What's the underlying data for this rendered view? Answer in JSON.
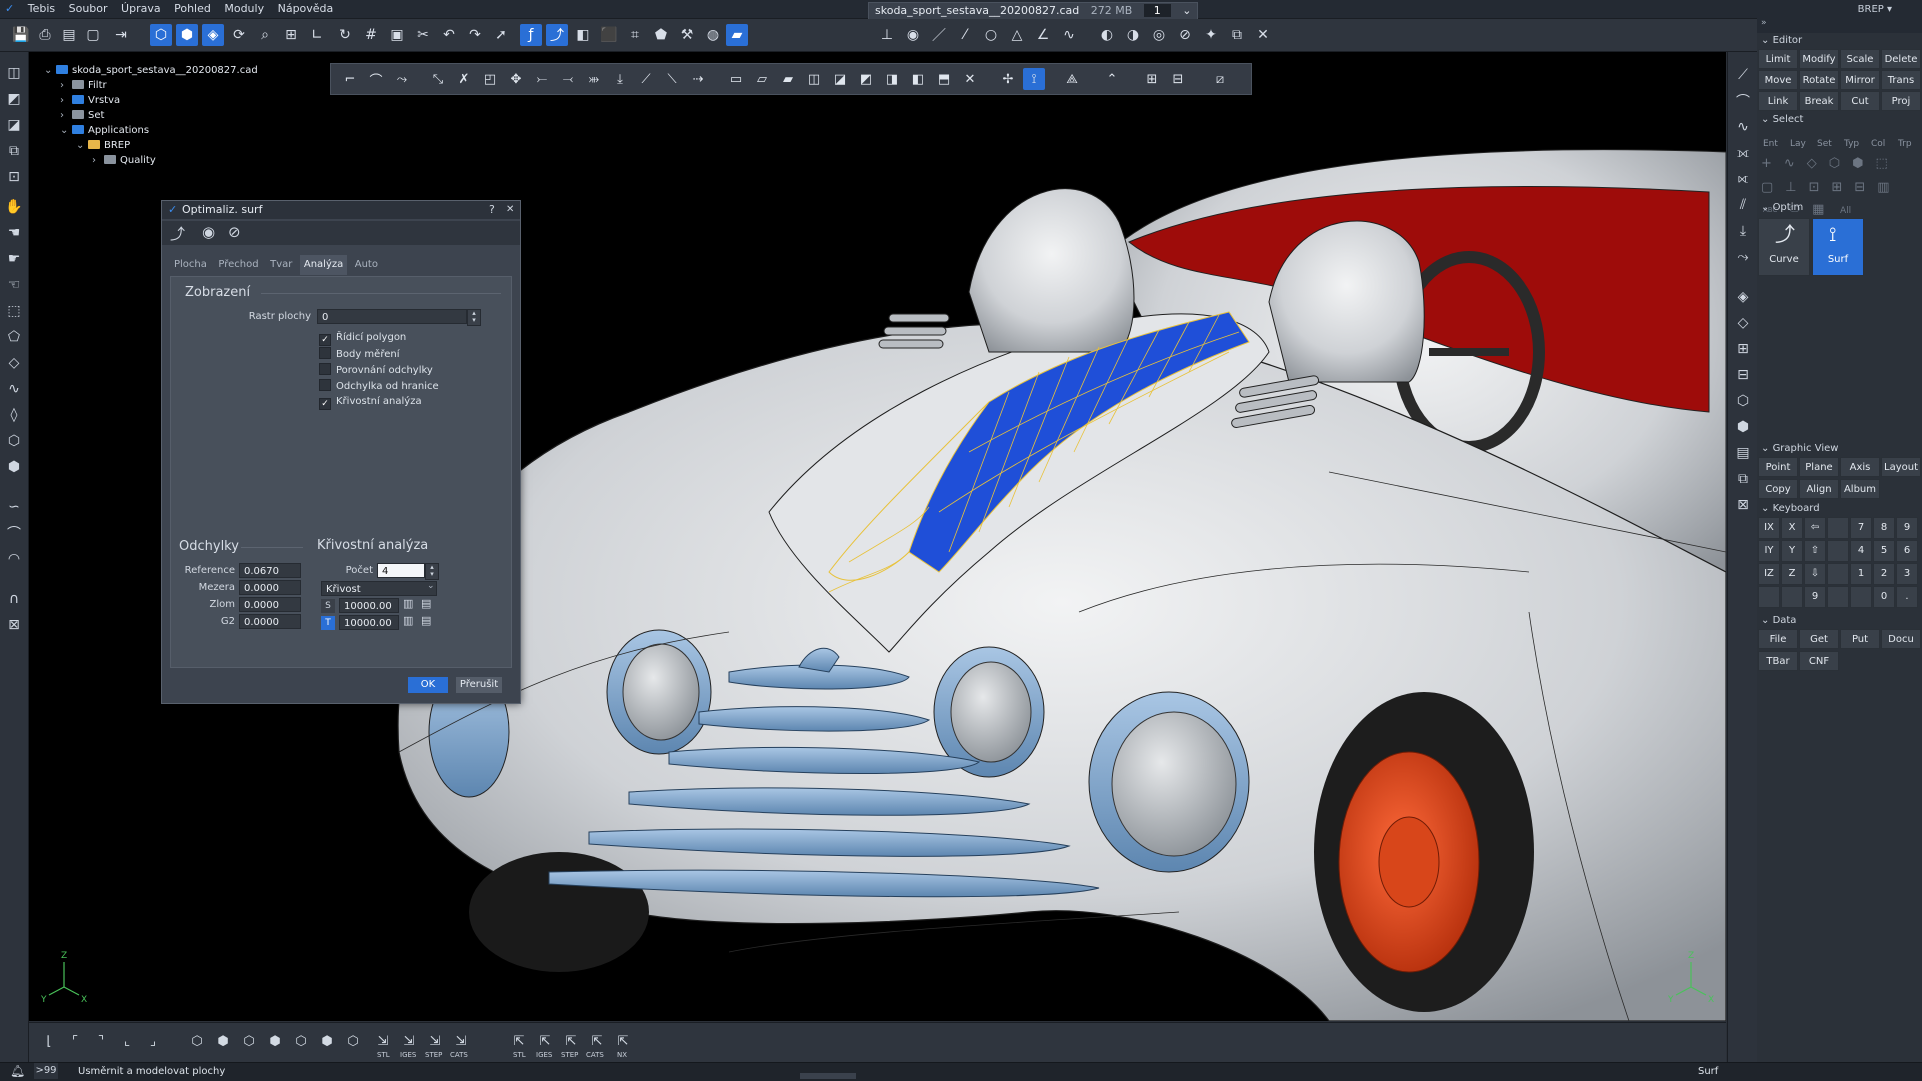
{
  "menu": {
    "app": "Tebis",
    "items": [
      "Soubor",
      "Úprava",
      "Pohled",
      "Moduly",
      "Nápověda"
    ]
  },
  "file_tab": {
    "name": "skoda_sport_sestava__20200827.cad",
    "size": "272 MB",
    "num": "1"
  },
  "mode_label": "BREP ▾",
  "tree": {
    "root": "skoda_sport_sestava__20200827.cad",
    "items": [
      {
        "label": "Filtr",
        "color": "#8a939e"
      },
      {
        "label": "Vrstva",
        "color": "#2f7fe0"
      },
      {
        "label": "Set",
        "color": "#8a939e"
      },
      {
        "label": "Applications",
        "color": "#2f7fe0"
      },
      {
        "label": "BREP",
        "color": "#e8b64a"
      },
      {
        "label": "Quality",
        "color": "#8a939e"
      }
    ]
  },
  "dialog": {
    "title": "Optimaliz. surf",
    "help": "?",
    "close": "✕",
    "tabs": [
      "Plocha",
      "Přechod",
      "Tvar",
      "Analýza",
      "Auto"
    ],
    "active_tab": "Analýza",
    "zobrazeni": {
      "title": "Zobrazení",
      "rastr_label": "Rastr plochy",
      "rastr_value": "0",
      "checkboxes": [
        {
          "label": "Řídicí polygon",
          "checked": true
        },
        {
          "label": "Body měření",
          "checked": false
        },
        {
          "label": "Porovnání odchylky",
          "checked": false
        },
        {
          "label": "Odchylka od hranice",
          "checked": false
        },
        {
          "label": "Křivostní analýza",
          "checked": true
        }
      ]
    },
    "odchylky": {
      "title": "Odchylky",
      "rows": [
        {
          "label": "Reference",
          "value": "0.0670"
        },
        {
          "label": "Mezera",
          "value": "0.0000"
        },
        {
          "label": "Zlom",
          "value": "0.0000"
        },
        {
          "label": "G2",
          "value": "0.0000"
        }
      ]
    },
    "krivost": {
      "title": "Křivostní analýza",
      "pocet_label": "Počet",
      "pocet_value": "4",
      "type_value": "Křivost",
      "s_label": "S",
      "s_value": "10000.00",
      "t_label": "T",
      "t_value": "10000.00"
    },
    "ok": "OK",
    "cancel": "Přerušit"
  },
  "right_panel": {
    "editor_title": "Editor",
    "editor_buttons": [
      "Limit",
      "Modify",
      "Scale",
      "Delete",
      "Move",
      "Rotate",
      "Mirror",
      "Trans",
      "Link",
      "Break",
      "Cut",
      "Proj"
    ],
    "select_title": "Select",
    "select_tabs": [
      "Ent",
      "Lay",
      "Set",
      "Typ",
      "Col",
      "Trp"
    ],
    "select_abc": "ABC",
    "select_all": "All",
    "optim_title": "Optim",
    "optim_buttons": [
      {
        "label": "Curve",
        "active": false
      },
      {
        "label": "Surf",
        "active": true
      }
    ],
    "graphic_title": "Graphic View",
    "graphic_buttons": [
      "Point",
      "Plane",
      "Axis",
      "Layout",
      "Copy",
      "Align",
      "Album"
    ],
    "keyboard_title": "Keyboard",
    "keyboard_keys": [
      "IX",
      "X",
      "⇦",
      "",
      "7",
      "8",
      "9",
      "IY",
      "Y",
      "⇧",
      "",
      "4",
      "5",
      "6",
      "IZ",
      "Z",
      "⇩",
      "",
      "1",
      "2",
      "3",
      "",
      "",
      "9",
      "",
      "",
      "0",
      "."
    ],
    "data_title": "Data",
    "data_buttons": [
      "File",
      "Get",
      "Put",
      "Docu",
      "TBar",
      "CNF"
    ]
  },
  "bottom_toolbar": {
    "export_labels_1": [
      "STL",
      "IGES",
      "STEP",
      "CATS"
    ],
    "export_labels_2": [
      "STL",
      "IGES",
      "STEP",
      "CATS",
      "NX"
    ]
  },
  "status": {
    "counter": ">99",
    "message": "Usměrnit a modelovat plochy",
    "mode": "Surf"
  },
  "colors": {
    "accent": "#2a6fd6",
    "body": "#d6d8db",
    "interior": "#9e0c0a",
    "wheel": "#e24318",
    "surface": "#1f4fd8",
    "chrome": "#7fa6cc",
    "wire": "#e8c23a"
  }
}
